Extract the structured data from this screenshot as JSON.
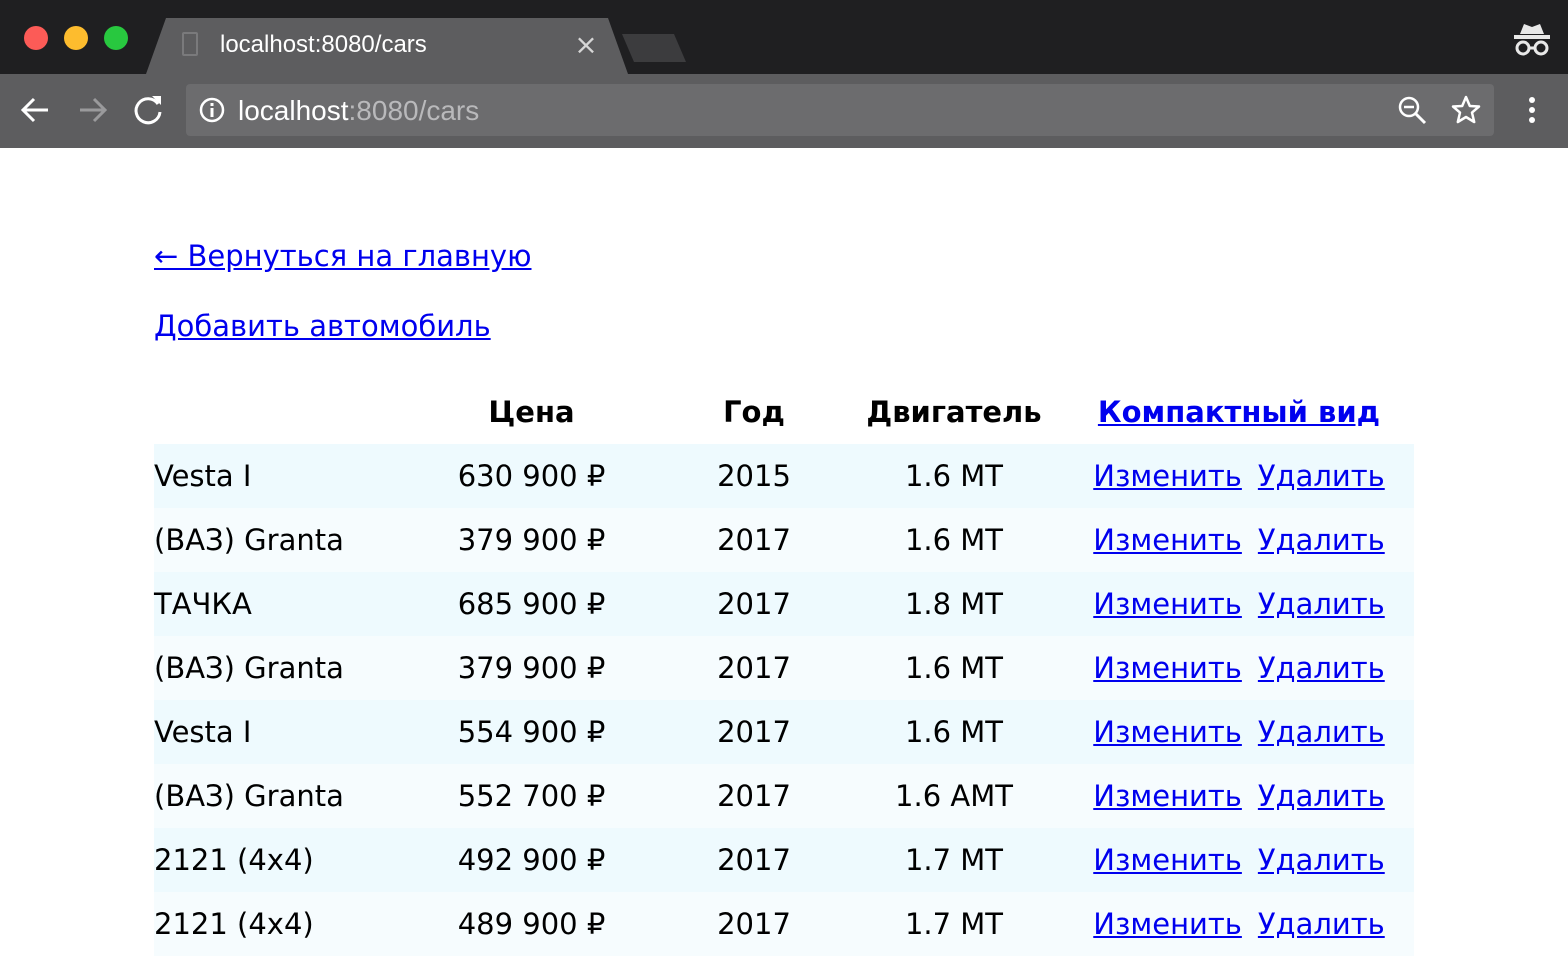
{
  "browser": {
    "tab_title": "localhost:8080/cars",
    "tab_close": "×",
    "url_host": "localhost",
    "url_rest": ":8080/cars"
  },
  "page": {
    "back_link": "← Вернуться на главную",
    "add_link": "Добавить автомобиль",
    "table": {
      "headers": {
        "model": "",
        "price": "Цена",
        "year": "Год",
        "engine": "Двигатель",
        "compact_view": "Компактный вид"
      },
      "edit_label": "Изменить",
      "delete_label": "Удалить",
      "rows": [
        {
          "model": "Vesta I",
          "price": "630 900 ₽",
          "year": "2015",
          "engine": "1.6 MT"
        },
        {
          "model": "(ВАЗ) Granta",
          "price": "379 900 ₽",
          "year": "2017",
          "engine": "1.6 MT"
        },
        {
          "model": "ТАЧКА",
          "price": "685 900 ₽",
          "year": "2017",
          "engine": "1.8 MT"
        },
        {
          "model": "(ВАЗ) Granta",
          "price": "379 900 ₽",
          "year": "2017",
          "engine": "1.6 MT"
        },
        {
          "model": "Vesta I",
          "price": "554 900 ₽",
          "year": "2017",
          "engine": "1.6 MT"
        },
        {
          "model": "(ВАЗ) Granta",
          "price": "552 700 ₽",
          "year": "2017",
          "engine": "1.6 AMT"
        },
        {
          "model": "2121 (4x4)",
          "price": "492 900 ₽",
          "year": "2017",
          "engine": "1.7 MT"
        },
        {
          "model": "2121 (4x4)",
          "price": "489 900 ₽",
          "year": "2017",
          "engine": "1.7 MT"
        }
      ]
    }
  },
  "colors": {
    "link": "#0000ee",
    "row_odd": "#eefafe",
    "row_even": "#f6fcfe",
    "titlebar": "#1f1f21",
    "toolbar": "#5d5d5f"
  }
}
